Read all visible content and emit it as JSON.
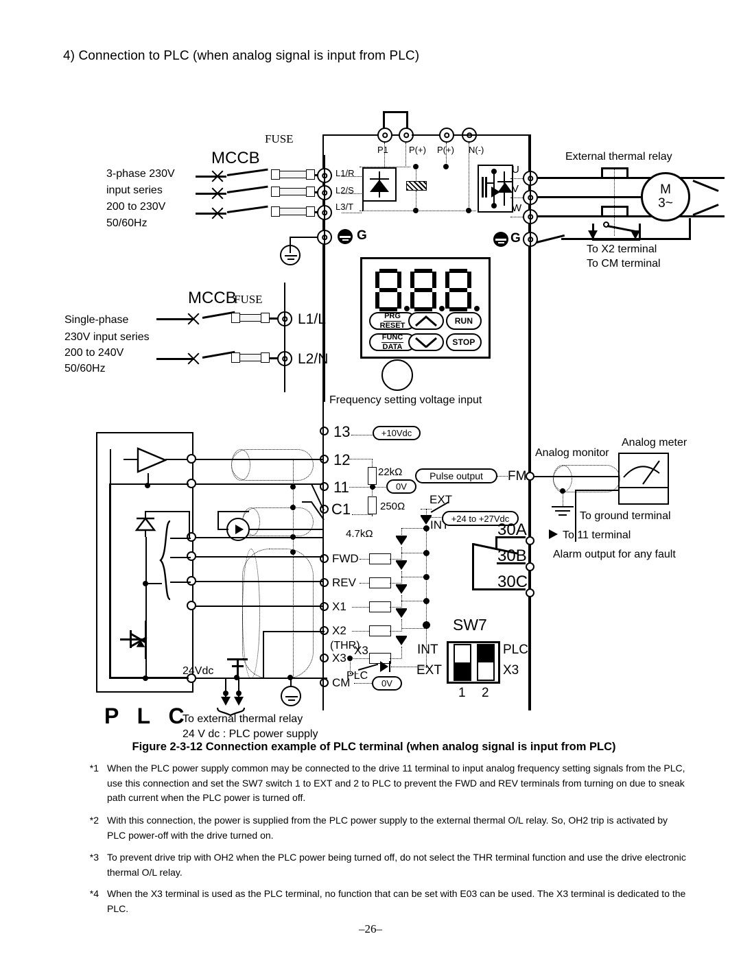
{
  "page": {
    "heading": "4) Connection to PLC (when analog signal is input from PLC)",
    "number": "–26–"
  },
  "figure": {
    "caption": "Figure 2-3-12  Connection example of PLC terminal (when analog signal is input from PLC)"
  },
  "power_three_phase": {
    "lines": [
      "3-phase 230V",
      "input series",
      "200 to 230V",
      "50/60Hz"
    ],
    "mccb_label": "MCCB",
    "fuse_label": "FUSE",
    "terminals": [
      "L1/R",
      "L2/S",
      "L3/T"
    ],
    "ground_label": "G"
  },
  "power_single_phase": {
    "lines": [
      "Single-phase",
      "230V  input  series",
      "200 to 240V",
      "50/60Hz"
    ],
    "mccb_label": "MCCB",
    "fuse_label": "FUSE",
    "terminals": [
      "L1/L",
      "L2/N"
    ]
  },
  "dc_bus": {
    "terminals": [
      "P1",
      "P(+)",
      "P(+)",
      "N(-)"
    ]
  },
  "output": {
    "terminals": [
      "U",
      "V",
      "W"
    ],
    "ground_label": "G",
    "thermal_relay_label": "External thermal relay",
    "motor_top": "M",
    "motor_bottom": "3~",
    "to_x2": "To X2 terminal",
    "to_cm": "To CM terminal"
  },
  "keypad": {
    "display": "8.8.8.",
    "keys": [
      {
        "top": "PRG",
        "bottom": "RESET"
      },
      {
        "top": "FUNC",
        "bottom": "DATA"
      }
    ],
    "run_label": "RUN",
    "stop_label": "STOP",
    "up_icon": "chevron-up-icon",
    "down_icon": "chevron-down-icon"
  },
  "control": {
    "freq_input_label": "Frequency setting voltage input",
    "terminals": [
      {
        "name": "13",
        "note": "+10Vdc"
      },
      {
        "name": "12",
        "note": ""
      },
      {
        "name": "11",
        "note": "0V"
      },
      {
        "name": "C1",
        "note": ""
      },
      {
        "name": "FWD",
        "note": ""
      },
      {
        "name": "REV",
        "note": ""
      },
      {
        "name": "X1",
        "note": ""
      },
      {
        "name": "X2",
        "note": ""
      },
      {
        "name": "X3",
        "note": ""
      },
      {
        "name": "CM",
        "note": "0V"
      }
    ],
    "resistor_22k": "22kΩ",
    "resistor_250": "250Ω",
    "resistor_47k": "4.7kΩ",
    "thr_label": "(THR)",
    "x3_alt_label": "X3",
    "plc_terminal_label": "PLC",
    "ext_label": "EXT",
    "int_label": "INT",
    "supply_note": "+24 to +27Vdc",
    "pulse_output": "Pulse output",
    "fm_terminal": "FM"
  },
  "alarm_relay": {
    "terminals": [
      "30A",
      "30B",
      "30C"
    ],
    "note": "Alarm output for any fault"
  },
  "analog": {
    "monitor_label": "Analog monitor",
    "meter_label": "Analog meter",
    "to_ground": "To ground terminal",
    "to_11": "To 11 terminal"
  },
  "sw7": {
    "title": "SW7",
    "left_top": "INT",
    "left_bottom": "EXT",
    "right_top": "PLC",
    "right_bottom": "X3",
    "pin1_label": "1",
    "pin2_label": "2",
    "pin1_state": "down",
    "pin2_state": "up"
  },
  "plc_block": {
    "caption": "P L C",
    "supply_label": "24Vdc",
    "to_thermal_relay": "To external thermal relay",
    "power_supply_note": "24 V dc : PLC power supply"
  },
  "notes": [
    {
      "marker": "*1",
      "text": "When the PLC power supply common may be connected to the drive 11 terminal to input analog frequency setting signals from the PLC, use this connection and set the SW7 switch 1 to EXT and 2 to PLC to prevent the FWD and REV terminals from turning on due to sneak path current when the PLC power is turned off."
    },
    {
      "marker": "*2",
      "text": "With this connection, the power is supplied from the PLC power supply to the external thermal O/L relay.  So, OH2 trip is activated by PLC power-off with the drive turned on."
    },
    {
      "marker": "*3",
      "text": "To prevent drive trip with OH2 when the PLC power being turned off, do not select the THR terminal function and use the drive electronic thermal O/L relay."
    },
    {
      "marker": "*4",
      "text": "When the X3 terminal is used as the PLC terminal, no function that can be set with E03 can be used.  The X3 terminal is dedicated to the PLC."
    }
  ]
}
